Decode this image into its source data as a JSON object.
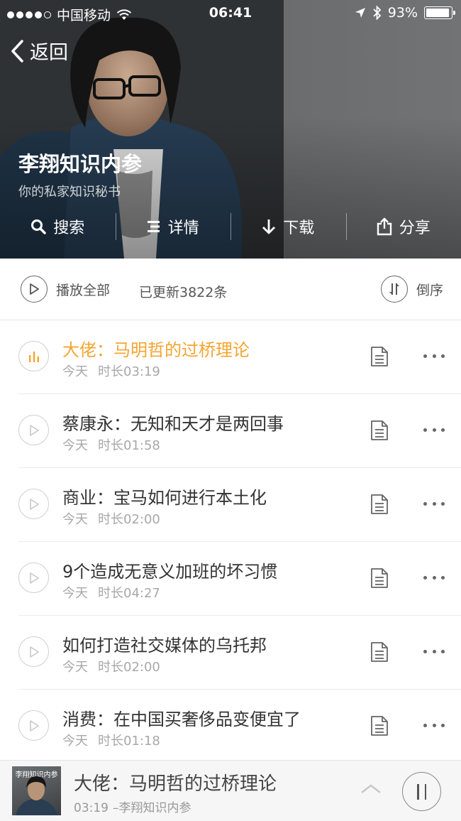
{
  "status_bar": {
    "carrier": "中国移动",
    "time": "06:41",
    "battery_text": "93%",
    "battery_level": 0.93
  },
  "header": {
    "back_label": "返回",
    "title": "李翔知识内参",
    "subtitle": "你的私家知识秘书",
    "actions": [
      {
        "label": "搜索",
        "icon": "search-icon"
      },
      {
        "label": "详情",
        "icon": "list-icon"
      },
      {
        "label": "下载",
        "icon": "download-icon"
      },
      {
        "label": "分享",
        "icon": "share-icon"
      }
    ]
  },
  "toolbar": {
    "play_all_label": "播放全部",
    "updated_text": "已更新3822条",
    "sort_label": "倒序"
  },
  "colors": {
    "accent": "#f5a430"
  },
  "episodes": [
    {
      "title": "大佬：马明哲的过桥理论",
      "date": "今天",
      "duration": "时长03:19",
      "playing": true
    },
    {
      "title": "蔡康永：无知和天才是两回事",
      "date": "今天",
      "duration": "时长01:58",
      "playing": false
    },
    {
      "title": "商业：宝马如何进行本土化",
      "date": "今天",
      "duration": "时长02:00",
      "playing": false
    },
    {
      "title": "9个造成无意义加班的坏习惯",
      "date": "今天",
      "duration": "时长04:27",
      "playing": false
    },
    {
      "title": "如何打造社交媒体的乌托邦",
      "date": "今天",
      "duration": "时长02:00",
      "playing": false
    },
    {
      "title": "消费：在中国买奢侈品变便宜了",
      "date": "今天",
      "duration": "时长01:18",
      "playing": false
    }
  ],
  "player": {
    "cover_text": "李翔知识内参",
    "title": "大佬：马明哲的过桥理论",
    "elapsed": "03:19",
    "source": "–李翔知识内参"
  }
}
